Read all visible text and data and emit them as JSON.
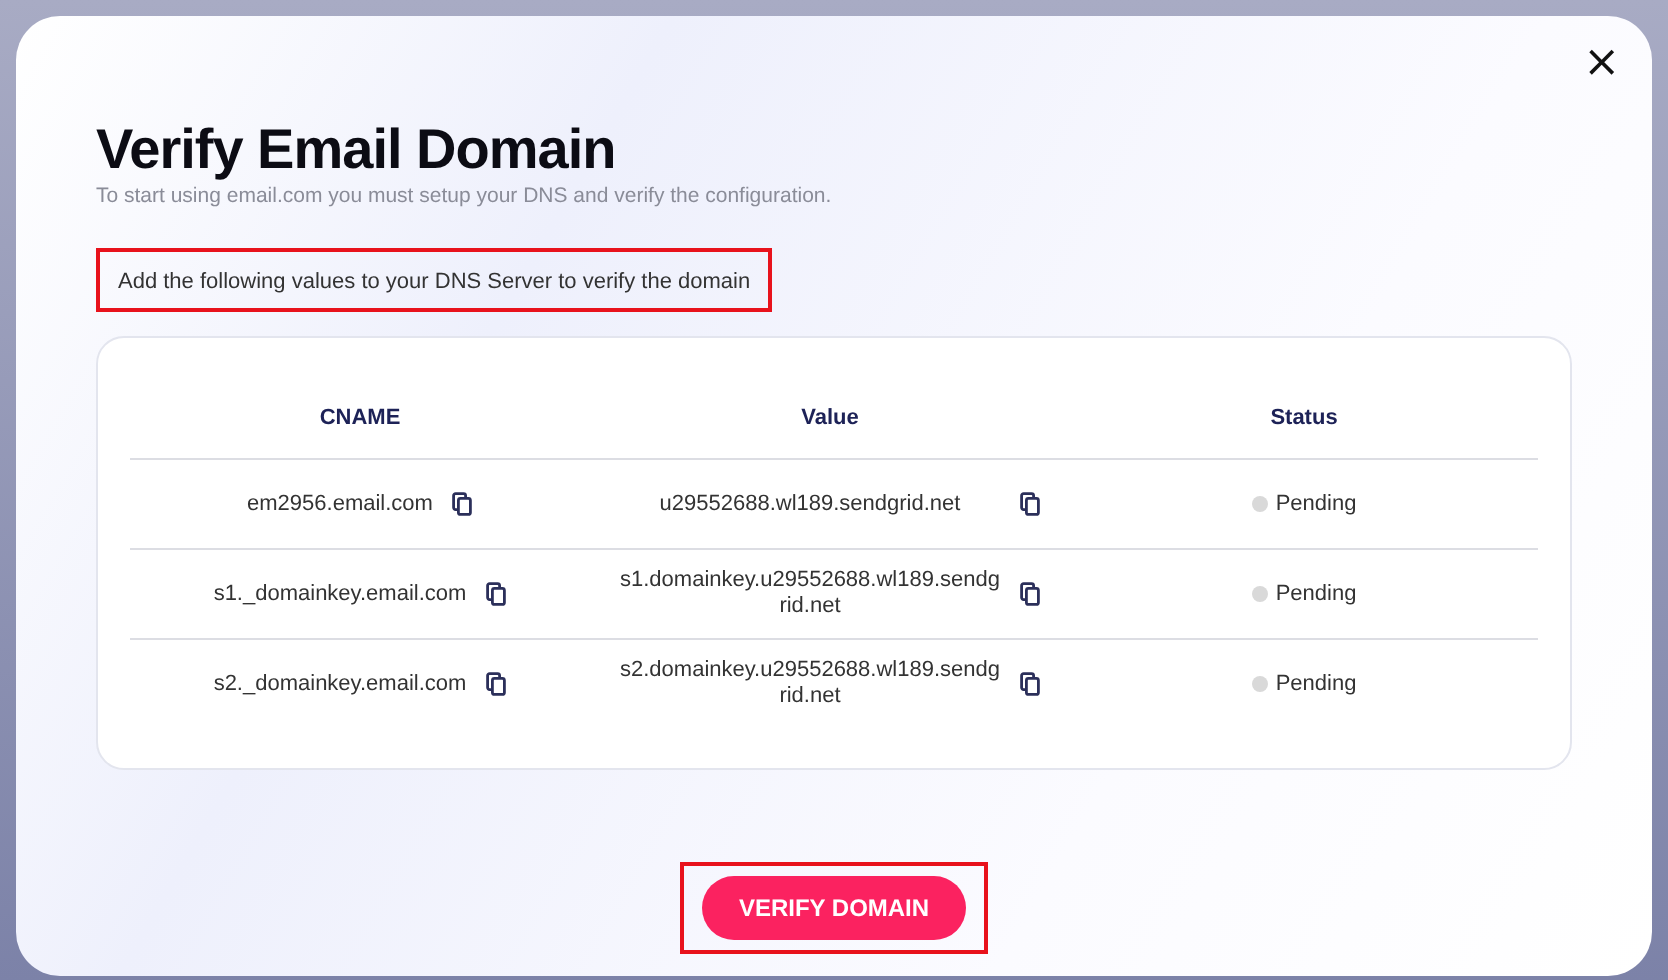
{
  "dialog": {
    "title": "Verify Email Domain",
    "subtitle": "To start using email.com you must setup your DNS and verify the configuration.",
    "close": "×"
  },
  "instruction": {
    "text": "Add the following values to your DNS Server to verify the domain",
    "highlighted": true
  },
  "table": {
    "columns": [
      "CNAME",
      "Value",
      "Status"
    ],
    "rows": [
      {
        "cname": "em2956.email.com",
        "value": "u29552688.wl189.sendgrid.net",
        "status": "Pending",
        "color": "#d9d9d9"
      },
      {
        "cname": "s1._domainkey.email.com",
        "value": "s1.domainkey.u29552688.wl189.sendgrid.net",
        "status": "Pending",
        "color": "#d9d9d9"
      },
      {
        "cname": "s2._domainkey.email.com",
        "value": "s2.domainkey.u29552688.wl189.sendgrid.net",
        "status": "Pending",
        "color": "#d9d9d9"
      }
    ]
  },
  "button": {
    "label": "VERIFY DOMAIN",
    "highlighted": true
  }
}
